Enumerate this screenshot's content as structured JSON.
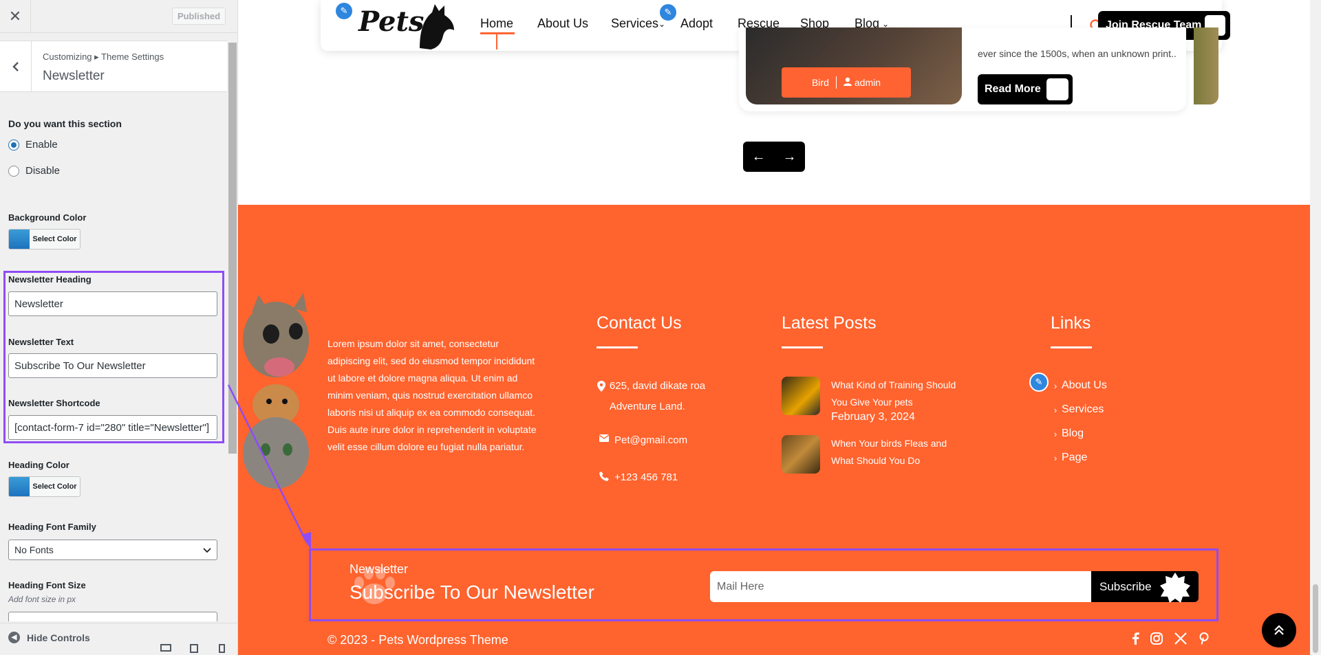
{
  "customizer": {
    "published_label": "Published",
    "breadcrumb": "Customizing ▸ Theme Settings",
    "title": "Newsletter",
    "section_question": "Do you want this section",
    "enable_label": "Enable",
    "disable_label": "Disable",
    "bg_color_label": "Background Color",
    "select_color_label": "Select Color",
    "heading_label": "Newsletter Heading",
    "heading_value": "Newsletter",
    "text_label": "Newsletter Text",
    "text_value": "Subscribe To Our Newsletter",
    "shortcode_label": "Newsletter Shortcode",
    "shortcode_value": "[contact-form-7 id=\"280\" title=\"Newsletter\"]",
    "heading_color_label": "Heading Color",
    "font_family_label": "Heading Font Family",
    "font_family_value": "No Fonts",
    "font_size_label": "Heading Font Size",
    "font_size_hint": "Add font size in px",
    "hide_controls_label": "Hide Controls",
    "accent_color": "#8e4cf5"
  },
  "site": {
    "logo_text": "Pets",
    "nav": {
      "items": [
        "Home",
        "About Us",
        "Services",
        "Adopt",
        "Rescue",
        "Shop",
        "Blog"
      ],
      "join_label": "Join Rescue Team"
    },
    "card": {
      "tag": "Bird",
      "author": "admin",
      "excerpt": "ever since the 1500s, when an unknown print...",
      "read_more": "Read More"
    },
    "footer": {
      "about": "Lorem ipsum dolor sit amet, consectetur adipiscing elit, sed do eiusmod tempor incididunt ut labore et dolore magna aliqua. Ut enim ad minim veniam, quis nostrud exercitation ullamco laboris nisi ut aliquip ex ea commodo consequat. Duis aute irure dolor in reprehenderit in voluptate velit esse cillum dolore eu fugiat nulla pariatur.",
      "contact_heading": "Contact Us",
      "address": "625, david dikate roa Adventure Land.",
      "email": "Pet@gmail.com",
      "phone": "+123 456 781",
      "posts_heading": "Latest Posts",
      "posts": [
        {
          "title": "What Kind of Training Should You Give Your pets",
          "date": "February 3, 2024"
        },
        {
          "title": "When Your birds Fleas and What Should You Do"
        }
      ],
      "links_heading": "Links",
      "links": [
        "About Us",
        "Services",
        "Blog",
        "Page"
      ],
      "newsletter_heading": "Newsletter",
      "newsletter_text": "Subscribe To Our Newsletter",
      "newsletter_placeholder": "Mail Here",
      "subscribe_label": "Subscribe",
      "copyright": "© 2023 - Pets Wordpress Theme",
      "brand_color": "#ff632e"
    }
  }
}
